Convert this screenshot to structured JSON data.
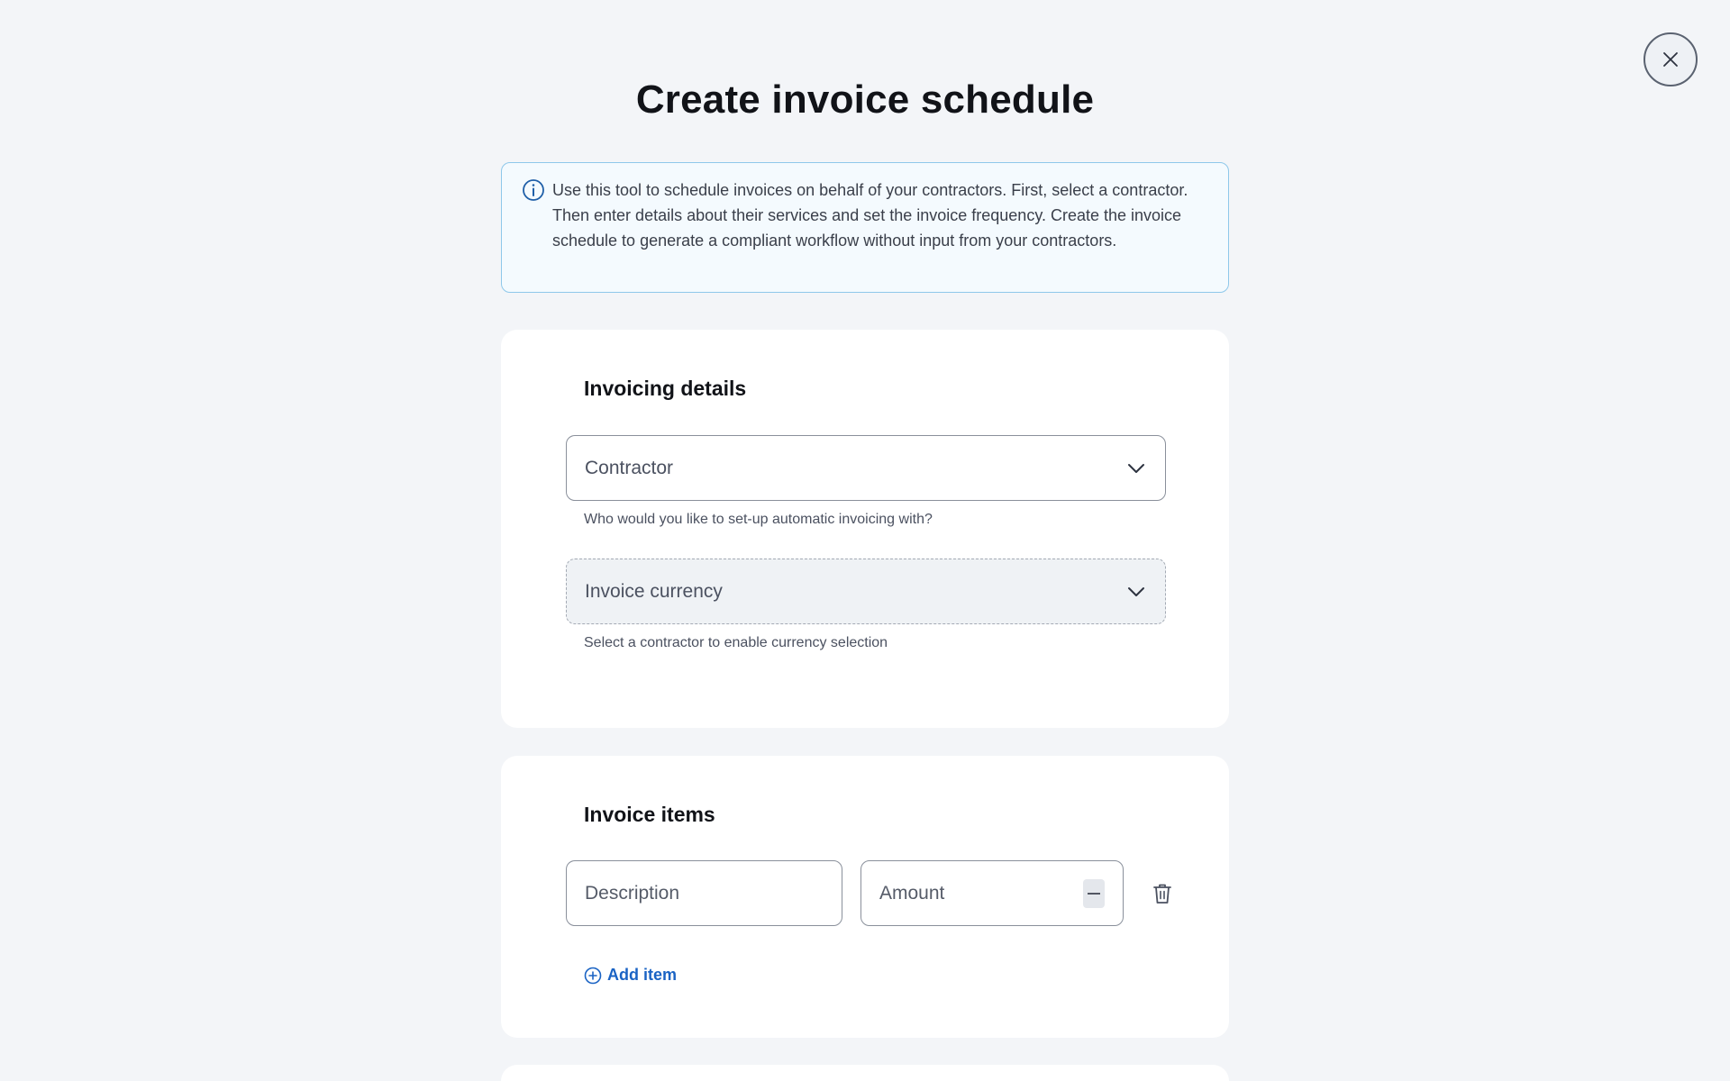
{
  "header": {
    "title": "Create invoice schedule",
    "close_icon": "close-icon"
  },
  "info_banner": {
    "icon": "info-icon",
    "text": "Use this tool to schedule invoices on behalf of your contractors. First, select a contractor. Then enter details about their services and set the invoice frequency. Create the invoice schedule to generate a compliant workflow without input from your contractors."
  },
  "invoicing_details": {
    "heading": "Invoicing details",
    "contractor": {
      "placeholder": "Contractor",
      "helper": "Who would you like to set-up automatic invoicing with?"
    },
    "currency": {
      "placeholder": "Invoice currency",
      "helper": "Select a contractor to enable currency selection",
      "disabled": true
    }
  },
  "invoice_items": {
    "heading": "Invoice items",
    "description_placeholder": "Description",
    "amount_placeholder": "Amount",
    "add_item_label": "Add item"
  },
  "colors": {
    "background": "#f3f5f8",
    "accent": "#1a63c4",
    "info_border": "#8ec8ea",
    "card": "#ffffff"
  }
}
